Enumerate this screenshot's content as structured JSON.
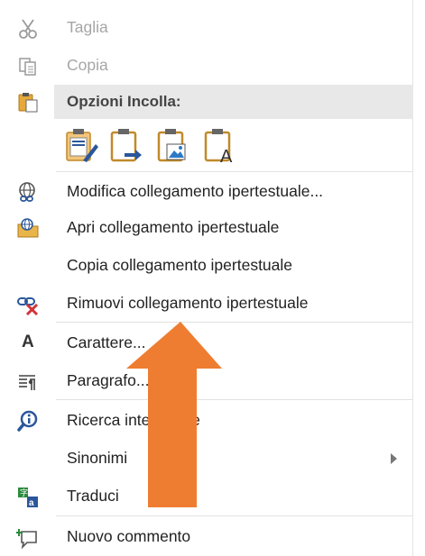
{
  "menu": {
    "items": [
      {
        "key": "cut",
        "label": "Taglia",
        "disabled": true
      },
      {
        "key": "copy",
        "label": "Copia",
        "disabled": true
      },
      {
        "key": "paste_header",
        "label": "Opzioni Incolla:"
      },
      {
        "key": "edit_link",
        "label": "Modifica collegamento ipertestuale..."
      },
      {
        "key": "open_link",
        "label": "Apri collegamento ipertestuale"
      },
      {
        "key": "copy_link",
        "label": "Copia collegamento ipertestuale"
      },
      {
        "key": "remove_link",
        "label": "Rimuovi collegamento ipertestuale"
      },
      {
        "key": "font",
        "label": "Carattere..."
      },
      {
        "key": "paragraph",
        "label": "Paragrafo..."
      },
      {
        "key": "smart_lookup",
        "label": "Ricerca intelligente"
      },
      {
        "key": "synonyms",
        "label": "Sinonimi"
      },
      {
        "key": "translate",
        "label": "Traduci"
      },
      {
        "key": "new_comment",
        "label": "Nuovo commento"
      }
    ],
    "icon_font_letter": "A",
    "paste_icon_letter": "A"
  },
  "colors": {
    "arrow": "#ee7d31",
    "disabled_text": "#a6a6a6",
    "header_bg": "#e8e8e8",
    "accent_blue": "#2b579a",
    "remove_red": "#d13438"
  }
}
